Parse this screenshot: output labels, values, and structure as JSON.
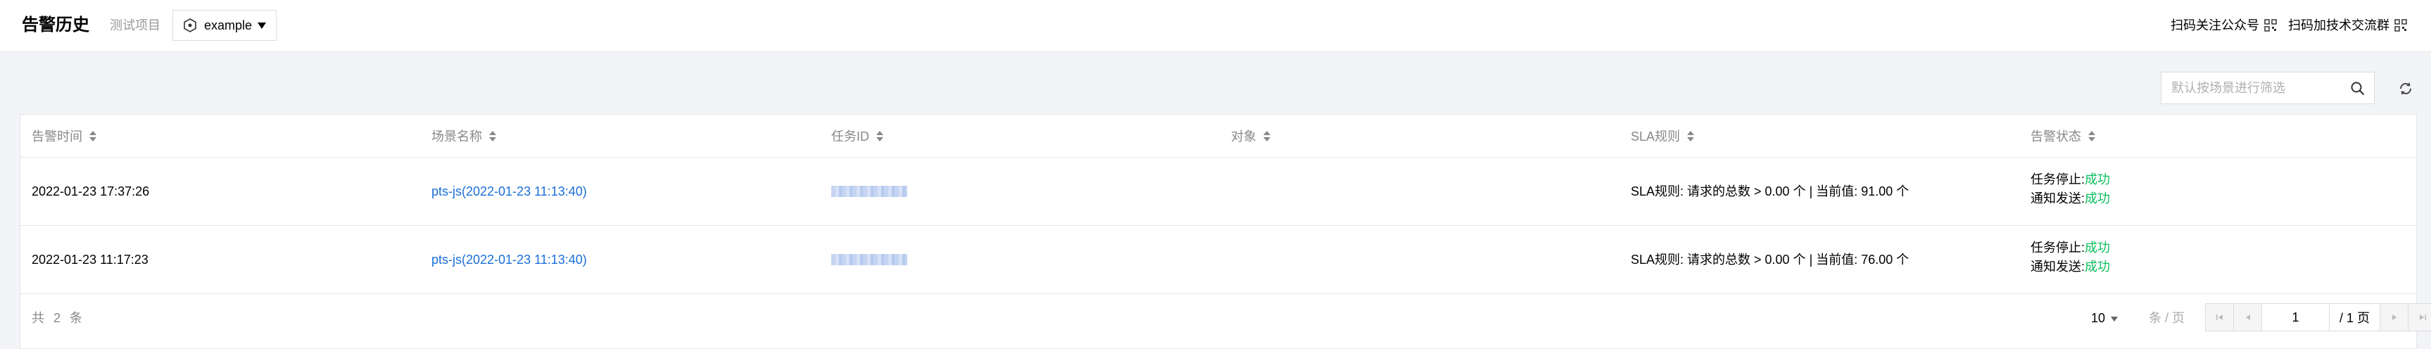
{
  "header": {
    "title": "告警历史",
    "project_label": "测试项目",
    "project_value": "example",
    "links": [
      "扫码关注公众号",
      "扫码加技术交流群"
    ]
  },
  "toolbar": {
    "search_placeholder": "默认按场景进行筛选"
  },
  "table": {
    "columns": [
      "告警时间",
      "场景名称",
      "任务ID",
      "对象",
      "SLA规则",
      "告警状态"
    ],
    "rows": [
      {
        "time": "2022-01-23 17:37:26",
        "scenario": "pts-js(2022-01-23 11:13:40)",
        "sla": "SLA规则: 请求的总数 > 0.00 个 | 当前值: 91.00 个",
        "status_lines": [
          {
            "label": "任务停止:",
            "value": "成功"
          },
          {
            "label": "通知发送:",
            "value": "成功"
          }
        ]
      },
      {
        "time": "2022-01-23 11:17:23",
        "scenario": "pts-js(2022-01-23 11:13:40)",
        "sla": "SLA规则: 请求的总数 > 0.00 个 | 当前值: 76.00 个",
        "status_lines": [
          {
            "label": "任务停止:",
            "value": "成功"
          },
          {
            "label": "通知发送:",
            "value": "成功"
          }
        ]
      }
    ]
  },
  "pagination": {
    "total_text": "共 2 条",
    "page_size": "10",
    "per_page_label": "条 / 页",
    "current_page": "1",
    "total_pages": "/ 1 页"
  },
  "colors": {
    "link": "#1a6ed8",
    "success": "#0abf5b"
  }
}
